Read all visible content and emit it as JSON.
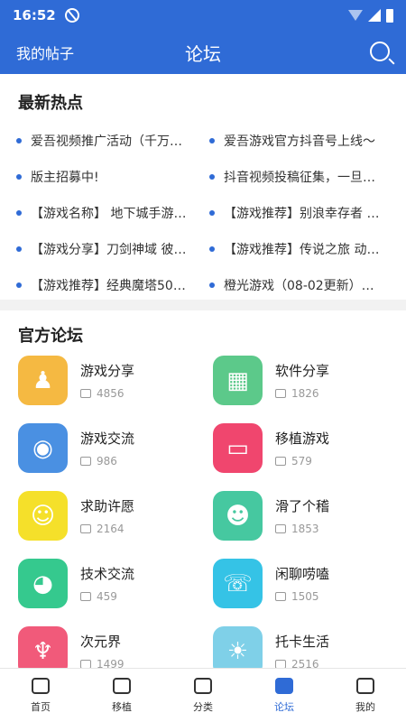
{
  "status_bar": {
    "time": "16:52"
  },
  "header": {
    "left": "我的帖子",
    "title": "论坛"
  },
  "hot": {
    "title": "最新热点",
    "items": [
      "爱吾视频推广活动（千万…",
      "爱吾游戏官方抖音号上线～",
      "版主招募中!",
      "抖音视频投稿征集，一旦…",
      "【游戏名称】 地下城手游…",
      "【游戏推荐】别浪幸存者 …",
      "【游戏分享】刀剑神域 彼…",
      "【游戏推荐】传说之旅 动…",
      "【游戏推荐】经典魔塔50…",
      "橙光游戏（08-02更新）…"
    ]
  },
  "official": {
    "title": "官方论坛",
    "forums": [
      {
        "name": "游戏分享",
        "count": "4856",
        "color": "#f5b942",
        "icon": "joystick-icon",
        "glyph": "♟"
      },
      {
        "name": "软件分享",
        "count": "1826",
        "color": "#5cc98a",
        "icon": "grid-apps-icon",
        "glyph": "▦"
      },
      {
        "name": "游戏交流",
        "count": "986",
        "color": "#4a90e2",
        "icon": "gamepad-icon",
        "glyph": "◉"
      },
      {
        "name": "移植游戏",
        "count": "579",
        "color": "#f0466e",
        "icon": "handheld-console-icon",
        "glyph": "▭"
      },
      {
        "name": "求助许愿",
        "count": "2164",
        "color": "#f5e02a",
        "icon": "smiley-icon",
        "glyph": "☺"
      },
      {
        "name": "滑了个稽",
        "count": "1853",
        "color": "#46c8a0",
        "icon": "chat-smile-icon",
        "glyph": "☻"
      },
      {
        "name": "技术交流",
        "count": "459",
        "color": "#35c98e",
        "icon": "pacman-icon",
        "glyph": "◕"
      },
      {
        "name": "闲聊唠嗑",
        "count": "1505",
        "color": "#35c3e6",
        "icon": "user-chat-icon",
        "glyph": "☏"
      },
      {
        "name": "次元界",
        "count": "1499",
        "color": "#f15a7a",
        "icon": "fox-mask-icon",
        "glyph": "♆"
      },
      {
        "name": "托卡生活",
        "count": "2516",
        "color": "#7fd0e8",
        "icon": "toca-character-icon",
        "glyph": "☀"
      }
    ]
  },
  "tabbar": {
    "tabs": [
      {
        "label": "首页",
        "icon": "home-icon"
      },
      {
        "label": "移植",
        "icon": "gamepad-icon"
      },
      {
        "label": "分类",
        "icon": "category-icon"
      },
      {
        "label": "论坛",
        "icon": "forum-icon",
        "active": true
      },
      {
        "label": "我的",
        "icon": "user-icon"
      }
    ]
  },
  "colors": {
    "primary": "#2f6bd6"
  }
}
